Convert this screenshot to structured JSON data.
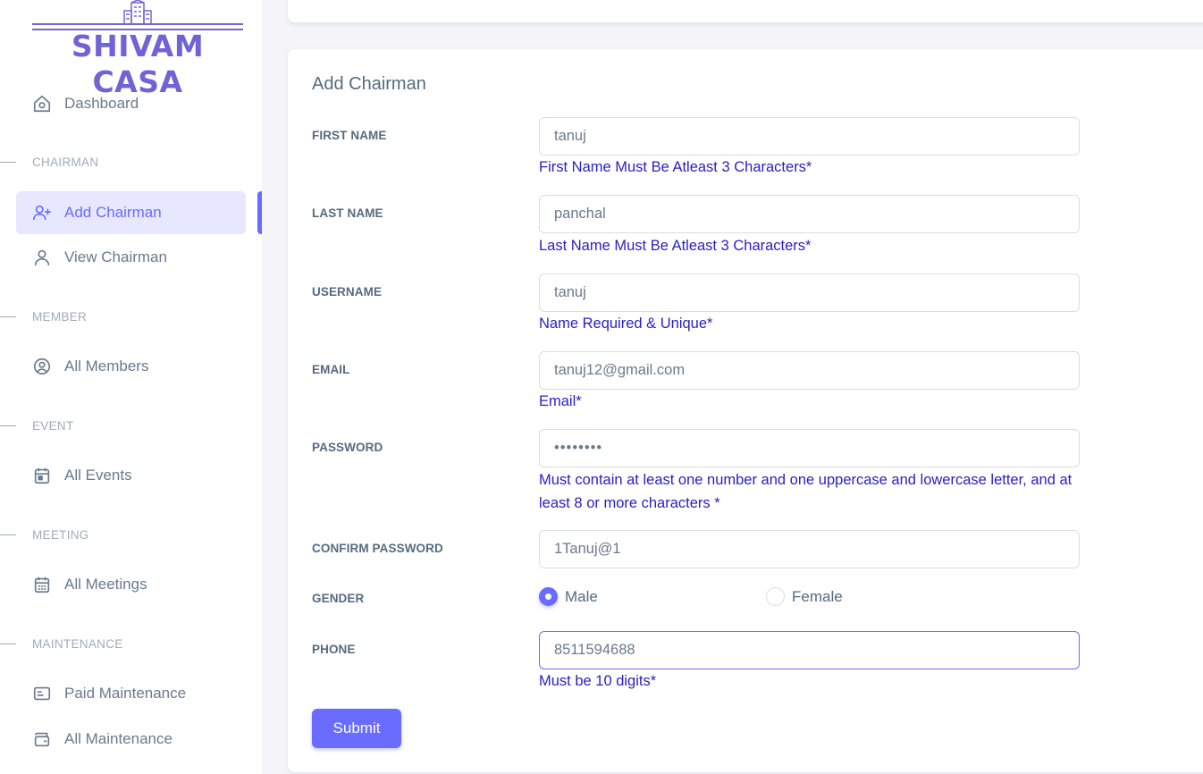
{
  "brand": {
    "name": "SHIVAM CASA"
  },
  "sidebar": {
    "dashboard": {
      "label": "Dashboard",
      "icon": "home-icon"
    },
    "sections": [
      {
        "header": "CHAIRMAN",
        "items": [
          {
            "label": "Add Chairman",
            "icon": "user-plus-icon",
            "active": true
          },
          {
            "label": "View Chairman",
            "icon": "user-icon"
          }
        ]
      },
      {
        "header": "MEMBER",
        "items": [
          {
            "label": "All Members",
            "icon": "user-circle-icon"
          }
        ]
      },
      {
        "header": "EVENT",
        "items": [
          {
            "label": "All Events",
            "icon": "calendar-icon"
          }
        ]
      },
      {
        "header": "MEETING",
        "items": [
          {
            "label": "All Meetings",
            "icon": "calendar-grid-icon"
          }
        ]
      },
      {
        "header": "MAINTENANCE",
        "items": [
          {
            "label": "Paid Maintenance",
            "icon": "id-card-icon"
          },
          {
            "label": "All Maintenance",
            "icon": "wallet-icon"
          }
        ]
      }
    ]
  },
  "form": {
    "title": "Add Chairman",
    "first_name": {
      "label": "FIRST NAME",
      "value": "tanuj",
      "hint": "First Name Must Be Atleast 3 Characters*"
    },
    "last_name": {
      "label": "LAST NAME",
      "value": "panchal",
      "hint": "Last Name Must Be Atleast 3 Characters*"
    },
    "username": {
      "label": "USERNAME",
      "value": "tanuj",
      "hint": "Name Required & Unique*"
    },
    "email": {
      "label": "EMAIL",
      "value": "tanuj12@gmail.com",
      "hint": "Email*"
    },
    "password": {
      "label": "PASSWORD",
      "value": "••••••••",
      "hint": "Must contain at least one number and one uppercase and lowercase letter, and at least 8 or more characters *"
    },
    "confirm_password": {
      "label": "CONFIRM PASSWORD",
      "value": "1Tanuj@1"
    },
    "gender": {
      "label": "GENDER",
      "options": [
        "Male",
        "Female"
      ],
      "selected": "Male"
    },
    "phone": {
      "label": "PHONE",
      "value": "8511594688",
      "hint": "Must be 10 digits*"
    },
    "submit_label": "Submit"
  },
  "colors": {
    "accent": "#696cff",
    "hint": "#2a1fc0",
    "brand": "#6f63d6"
  }
}
